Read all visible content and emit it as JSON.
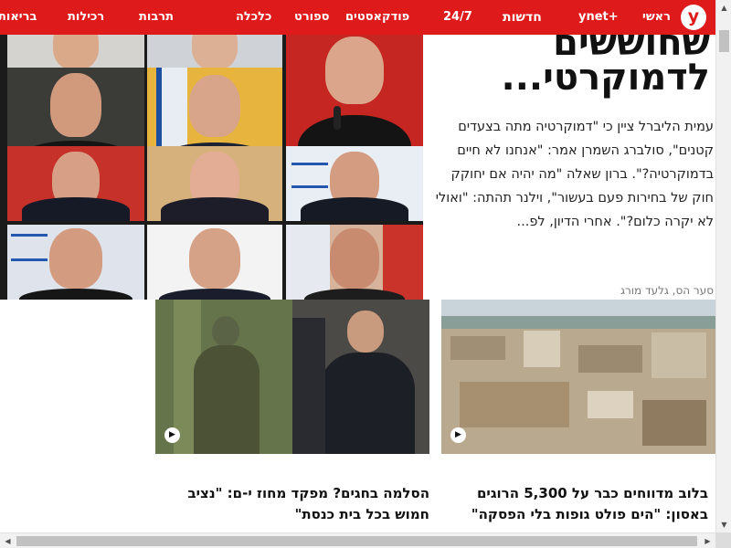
{
  "nav": {
    "logo": "y",
    "items": [
      "ראשי",
      "ynet+",
      "חדשות",
      "24/7",
      "פודקאסטים",
      "ספורט",
      "כלכלה",
      "תרבות",
      "רכילות",
      "בריאות"
    ]
  },
  "feature": {
    "headline_line1": "שחוששים",
    "headline_line2": "לדמוקרטי...",
    "lead": "עמית הליברל ציין כי \"דמוקרטיה מתה בצעדים קטנים\", סולברג השמרן אמר: \"אנחנו לא חיים בדמוקרטיה?\". ברון שאלה \"מה יהיה אם יחוקק חוק של בחירות פעם בעשור\", וילנר תהתה: \"ואולי לא יקרה כלום?\". אחרי הדיון, לפ...",
    "authors": "סער הס, גלעד מורג"
  },
  "cards": [
    {
      "title": "בלוב מדווחים כבר על 5,300 הרוגים באסון: \"הים פולט גופות בלי הפסקה\"",
      "play_icon": "▶"
    },
    {
      "title": "הסלמה בחגים? מפקד מחוז י-ם: \"נציב חמוש בכל בית כנסת\"",
      "play_icon": "▶"
    }
  ],
  "scroll": {
    "up": "▲",
    "down": "▼",
    "left": "◀",
    "right": "▶"
  },
  "colors": {
    "brand_red": "#de1a1a",
    "text": "#111111",
    "muted": "#777777"
  }
}
